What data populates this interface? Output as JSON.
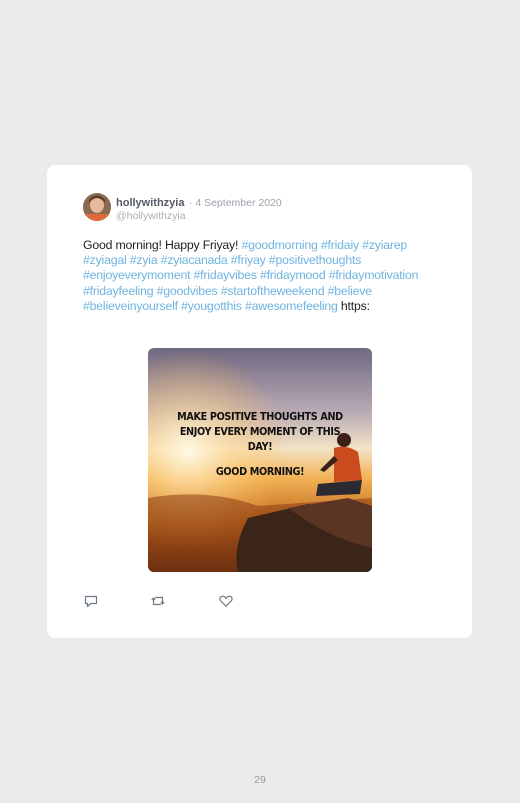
{
  "tweet": {
    "display_name": "hollywithzyia",
    "date": "· 4 September 2020",
    "handle": "@hollywithzyia",
    "text_plain_1": "Good morning! Happy Friyay! ",
    "hashtags": [
      "#goodmorning",
      "#fridaiy",
      "#zyiarep",
      "#zyiagal",
      "#zyia",
      "#zyiacanada",
      "#friyay",
      "#positivethoughts",
      "#enjoyeverymoment",
      "#fridayvibes",
      "#fridaymood",
      "#fridaymotivation",
      "#fridayfeeling",
      "#goodvibes",
      "#startoftheweekend",
      "#believe",
      "#believeinyourself",
      "#yougotthis",
      "#awesomefeeling"
    ],
    "text_plain_2": " https:",
    "image": {
      "line1": "MAKE POSITIVE THOUGHTS AND",
      "line2": "ENJOY EVERY MOMENT OF THIS",
      "line3": "DAY!",
      "line4": "GOOD MORNING!"
    },
    "actions": {
      "reply_icon": "comment-icon",
      "retweet_icon": "retweet-icon",
      "like_icon": "heart-icon"
    }
  },
  "page_number": "29",
  "colors": {
    "background": "#ebebe9",
    "card": "#ffffff",
    "hashtag": "#6fb3e0",
    "text": "#222222",
    "icon": "#6a7a88"
  }
}
